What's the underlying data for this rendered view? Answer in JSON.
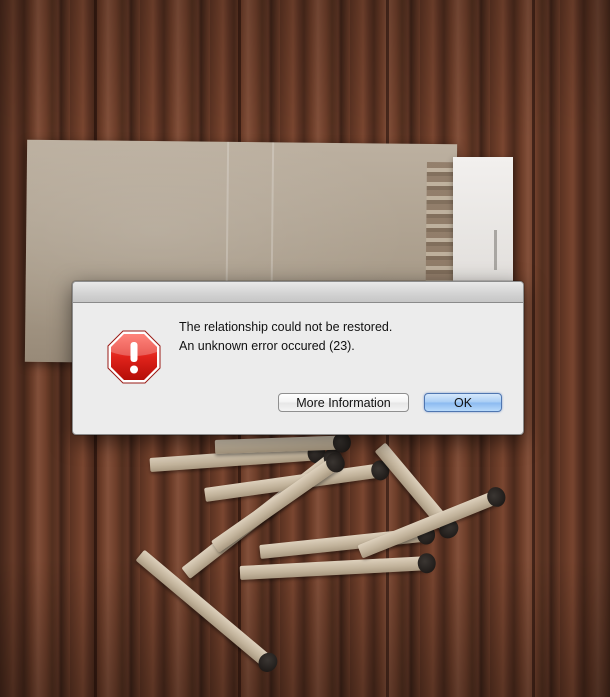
{
  "alert": {
    "message_line1": "The relationship could not be restored.",
    "message_line2": "An unknown error occured (23).",
    "icon": "stop-sign-alert-icon",
    "icon_color": "#e0231b",
    "buttons": {
      "more_info_label": "More Information",
      "ok_label": "OK"
    },
    "default_button_color": "#a9cdf5"
  },
  "background": {
    "scene": "wood-surface-with-matchbook-and-burnt-matches",
    "wood_color": "#6b3c28",
    "matchbook_color": "#a99c8a"
  }
}
